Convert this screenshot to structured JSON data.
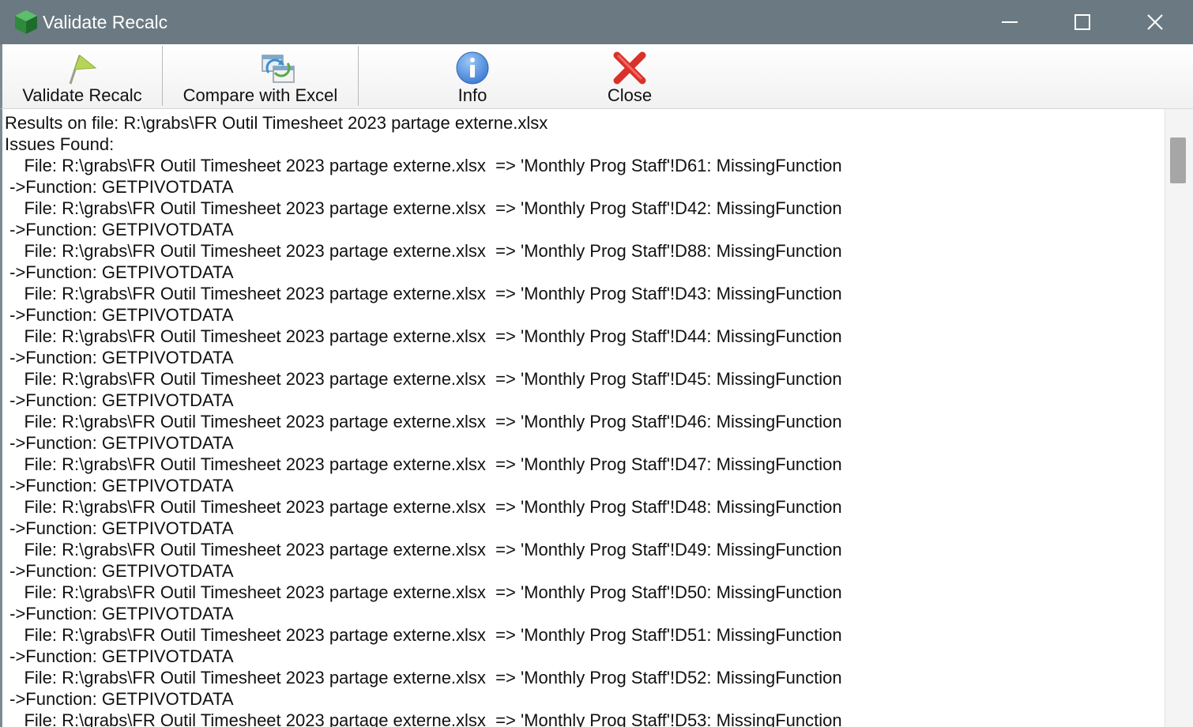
{
  "window": {
    "title": "Validate Recalc",
    "app_icon": "green-cube-icon",
    "controls": {
      "minimize_icon": "minimize-icon",
      "maximize_icon": "maximize-icon",
      "close_icon": "close-icon"
    }
  },
  "toolbar": {
    "buttons": [
      {
        "label": "Validate Recalc",
        "icon": "flag-icon"
      },
      {
        "label": "Compare with Excel",
        "icon": "compare-sync-icon"
      },
      {
        "label": "Info",
        "icon": "info-icon"
      },
      {
        "label": "Close",
        "icon": "red-x-icon"
      }
    ]
  },
  "results": {
    "header_line": "Results on file: R:\\grabs\\FR Outil Timesheet 2023 partage externe.xlsx",
    "issues_label": "Issues Found:",
    "lines": [
      "    File: R:\\grabs\\FR Outil Timesheet 2023 partage externe.xlsx  => 'Monthly Prog Staff'!D61: MissingFunction",
      " ->Function: GETPIVOTDATA",
      "    File: R:\\grabs\\FR Outil Timesheet 2023 partage externe.xlsx  => 'Monthly Prog Staff'!D42: MissingFunction",
      " ->Function: GETPIVOTDATA",
      "    File: R:\\grabs\\FR Outil Timesheet 2023 partage externe.xlsx  => 'Monthly Prog Staff'!D88: MissingFunction",
      " ->Function: GETPIVOTDATA",
      "    File: R:\\grabs\\FR Outil Timesheet 2023 partage externe.xlsx  => 'Monthly Prog Staff'!D43: MissingFunction",
      " ->Function: GETPIVOTDATA",
      "    File: R:\\grabs\\FR Outil Timesheet 2023 partage externe.xlsx  => 'Monthly Prog Staff'!D44: MissingFunction",
      " ->Function: GETPIVOTDATA",
      "    File: R:\\grabs\\FR Outil Timesheet 2023 partage externe.xlsx  => 'Monthly Prog Staff'!D45: MissingFunction",
      " ->Function: GETPIVOTDATA",
      "    File: R:\\grabs\\FR Outil Timesheet 2023 partage externe.xlsx  => 'Monthly Prog Staff'!D46: MissingFunction",
      " ->Function: GETPIVOTDATA",
      "    File: R:\\grabs\\FR Outil Timesheet 2023 partage externe.xlsx  => 'Monthly Prog Staff'!D47: MissingFunction",
      " ->Function: GETPIVOTDATA",
      "    File: R:\\grabs\\FR Outil Timesheet 2023 partage externe.xlsx  => 'Monthly Prog Staff'!D48: MissingFunction",
      " ->Function: GETPIVOTDATA",
      "    File: R:\\grabs\\FR Outil Timesheet 2023 partage externe.xlsx  => 'Monthly Prog Staff'!D49: MissingFunction",
      " ->Function: GETPIVOTDATA",
      "    File: R:\\grabs\\FR Outil Timesheet 2023 partage externe.xlsx  => 'Monthly Prog Staff'!D50: MissingFunction",
      " ->Function: GETPIVOTDATA",
      "    File: R:\\grabs\\FR Outil Timesheet 2023 partage externe.xlsx  => 'Monthly Prog Staff'!D51: MissingFunction",
      " ->Function: GETPIVOTDATA",
      "    File: R:\\grabs\\FR Outil Timesheet 2023 partage externe.xlsx  => 'Monthly Prog Staff'!D52: MissingFunction",
      " ->Function: GETPIVOTDATA",
      "    File: R:\\grabs\\FR Outil Timesheet 2023 partage externe.xlsx  => 'Monthly Prog Staff'!D53: MissingFunction"
    ]
  },
  "colors": {
    "titlebar": "#6b7a82",
    "text": "#111111",
    "close_x": "#d9322b",
    "info": "#3f7fd6"
  }
}
